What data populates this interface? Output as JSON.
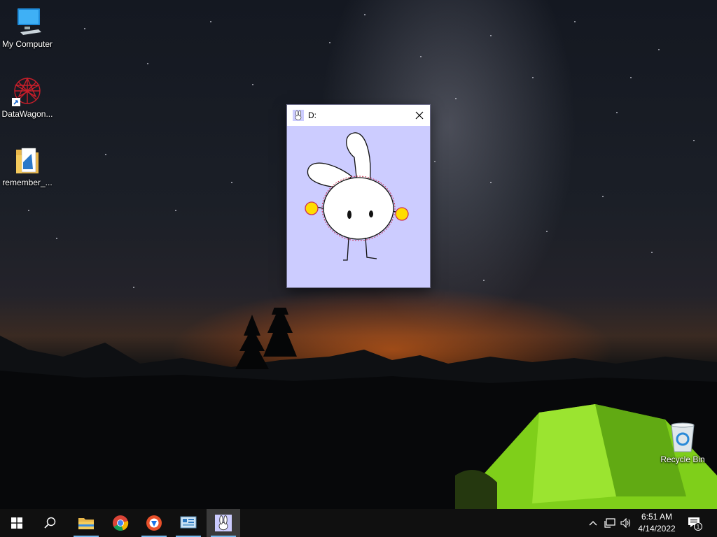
{
  "desktop": {
    "icons": [
      {
        "label": "My Computer",
        "icon": "computer-icon"
      },
      {
        "label": "DataWagon...",
        "icon": "datawagon-icon"
      },
      {
        "label": "remember_...",
        "icon": "folder-icon"
      },
      {
        "label": "Recycle Bin",
        "icon": "recycle-bin-icon"
      }
    ]
  },
  "window": {
    "title": "D:",
    "app_icon": "bunny-app-icon",
    "background": "#ccccff",
    "content": "bunny-character"
  },
  "taskbar": {
    "items": [
      {
        "name": "start",
        "icon": "windows-start-icon"
      },
      {
        "name": "search",
        "icon": "search-icon"
      },
      {
        "name": "file-explorer",
        "icon": "folder-icon",
        "running": true
      },
      {
        "name": "chrome",
        "icon": "chrome-icon",
        "running": false
      },
      {
        "name": "browser",
        "icon": "browser-icon",
        "running": true
      },
      {
        "name": "control-panel",
        "icon": "control-panel-icon",
        "running": true
      },
      {
        "name": "bunny-app",
        "icon": "bunny-app-icon",
        "running": true,
        "focused": true
      }
    ],
    "tray": {
      "icons": [
        "chevron-up-icon",
        "network-icon",
        "volume-icon"
      ],
      "time": "6:51 AM",
      "date": "4/14/2022",
      "notifications_count": "1"
    }
  },
  "colors": {
    "taskbar": "#101010",
    "accent": "#76b9ed",
    "tent": "#7fcf1a"
  }
}
